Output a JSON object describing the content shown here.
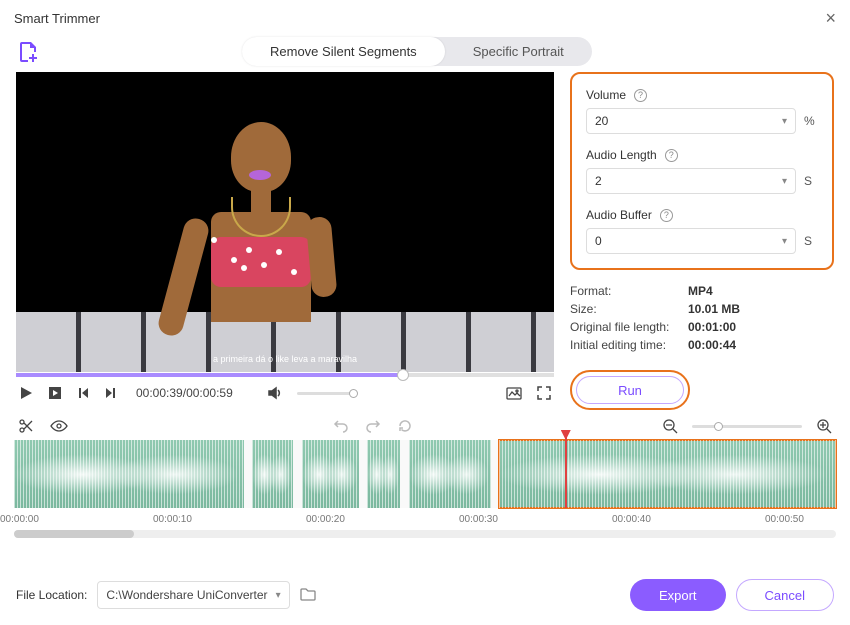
{
  "window": {
    "title": "Smart Trimmer"
  },
  "tabs": {
    "remove_silent": "Remove Silent Segments",
    "specific_portrait": "Specific Portrait"
  },
  "preview": {
    "subtitle": "a primeira dá o like leva a maravilha"
  },
  "playback": {
    "current": "00:00:39",
    "total": "00:00:59"
  },
  "settings": {
    "volume_label": "Volume",
    "volume_value": "20",
    "volume_unit": "%",
    "audio_length_label": "Audio Length",
    "audio_length_value": "2",
    "audio_length_unit": "S",
    "audio_buffer_label": "Audio Buffer",
    "audio_buffer_value": "0",
    "audio_buffer_unit": "S"
  },
  "meta": {
    "format_label": "Format:",
    "format_value": "MP4",
    "size_label": "Size:",
    "size_value": "10.01 MB",
    "orig_len_label": "Original file length:",
    "orig_len_value": "00:01:00",
    "init_edit_label": "Initial editing time:",
    "init_edit_value": "00:00:44"
  },
  "buttons": {
    "run": "Run",
    "export": "Export",
    "cancel": "Cancel"
  },
  "ruler": [
    "00:00:00",
    "00:00:10",
    "00:00:20",
    "00:00:30",
    "00:00:40",
    "00:00:50"
  ],
  "file_location": {
    "label": "File Location:",
    "path": "C:\\Wondershare UniConverter"
  },
  "waveform_segments": [
    {
      "start_pct": 0,
      "width_pct": 28,
      "selected": false
    },
    {
      "start_pct": 29,
      "width_pct": 5,
      "selected": false
    },
    {
      "start_pct": 35,
      "width_pct": 7,
      "selected": false
    },
    {
      "start_pct": 43,
      "width_pct": 4,
      "selected": false
    },
    {
      "start_pct": 48,
      "width_pct": 10,
      "selected": false
    },
    {
      "start_pct": 59,
      "width_pct": 41,
      "selected": true
    }
  ]
}
